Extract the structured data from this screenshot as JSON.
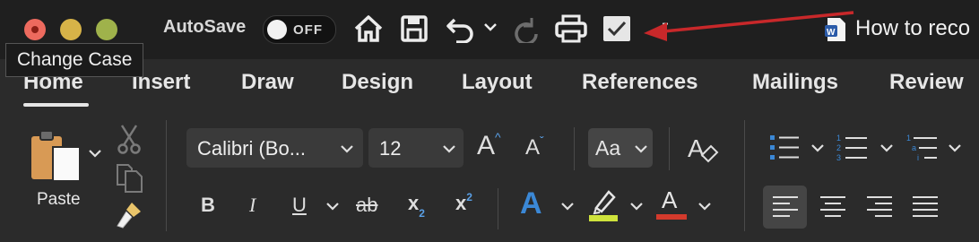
{
  "window": {
    "traffic_lights": [
      "close",
      "minimize",
      "maximize"
    ],
    "document_title": "How to reco"
  },
  "tooltip": {
    "text": "Change Case"
  },
  "quick_access": {
    "autosave_label": "AutoSave",
    "autosave_state": "OFF",
    "icons": [
      "home-icon",
      "save-icon",
      "undo-icon",
      "undo-dropdown-icon",
      "redo-icon",
      "print-icon",
      "checkbox-icon",
      "more-dash"
    ]
  },
  "ribbon": {
    "tabs": [
      {
        "label": "Home",
        "selected": true
      },
      {
        "label": "Insert"
      },
      {
        "label": "Draw"
      },
      {
        "label": "Design"
      },
      {
        "label": "Layout"
      },
      {
        "label": "References"
      },
      {
        "label": "Mailings"
      },
      {
        "label": "Review"
      }
    ],
    "clipboard": {
      "paste_label": "Paste"
    },
    "font": {
      "name": "Calibri (Bo...",
      "size": "12",
      "grow_label": "A",
      "shrink_label": "A",
      "change_case_label": "Aa",
      "bold": "B",
      "italic": "I",
      "underline": "U",
      "strike": "ab",
      "subscript_base": "x",
      "subscript_index": "2",
      "superscript_base": "x",
      "superscript_index": "2",
      "text_effects": "A",
      "font_color": "A"
    }
  },
  "colors": {
    "background": "#2b2b2b",
    "titlebar": "#1f1f1f",
    "annotation_arrow": "#c8282a",
    "highlight_yellow": "#cfe33c",
    "font_color_red": "#d33a2c",
    "accent_blue": "#3b88d6"
  }
}
